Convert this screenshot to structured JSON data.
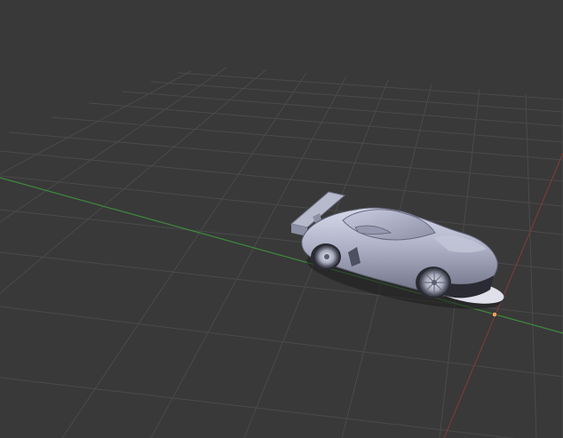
{
  "viewport": {
    "background_color": "#393939",
    "grid_color": "#4a4a4a",
    "x_axis_color": "#3d8a3d",
    "y_axis_color": "#7a3a3a",
    "origin_color": "#f0a060",
    "object_name": "sports-car-model"
  }
}
